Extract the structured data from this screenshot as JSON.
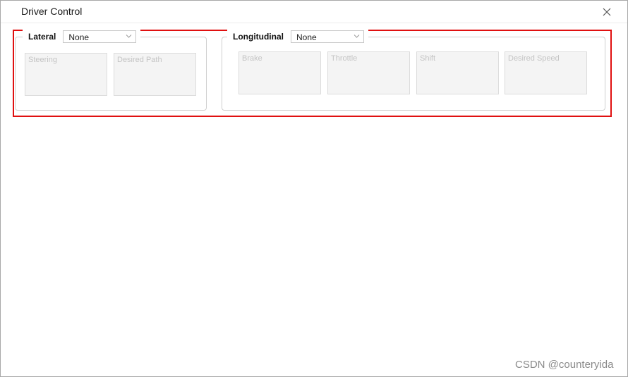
{
  "window": {
    "title": "Driver Control"
  },
  "lateral": {
    "label": "Lateral",
    "mode": "None",
    "tiles": [
      "Steering",
      "Desired Path"
    ]
  },
  "longitudinal": {
    "label": "Longitudinal",
    "mode": "None",
    "tiles": [
      "Brake",
      "Throttle",
      "Shift",
      "Desired Speed"
    ]
  },
  "watermark": "CSDN @counteryida",
  "colors": {
    "highlight": "#e01010",
    "tile_bg": "#f4f4f4",
    "tile_text": "#c4c4c4"
  },
  "icons": {
    "close": "close-icon",
    "dropdown": "chevron-down-icon"
  }
}
